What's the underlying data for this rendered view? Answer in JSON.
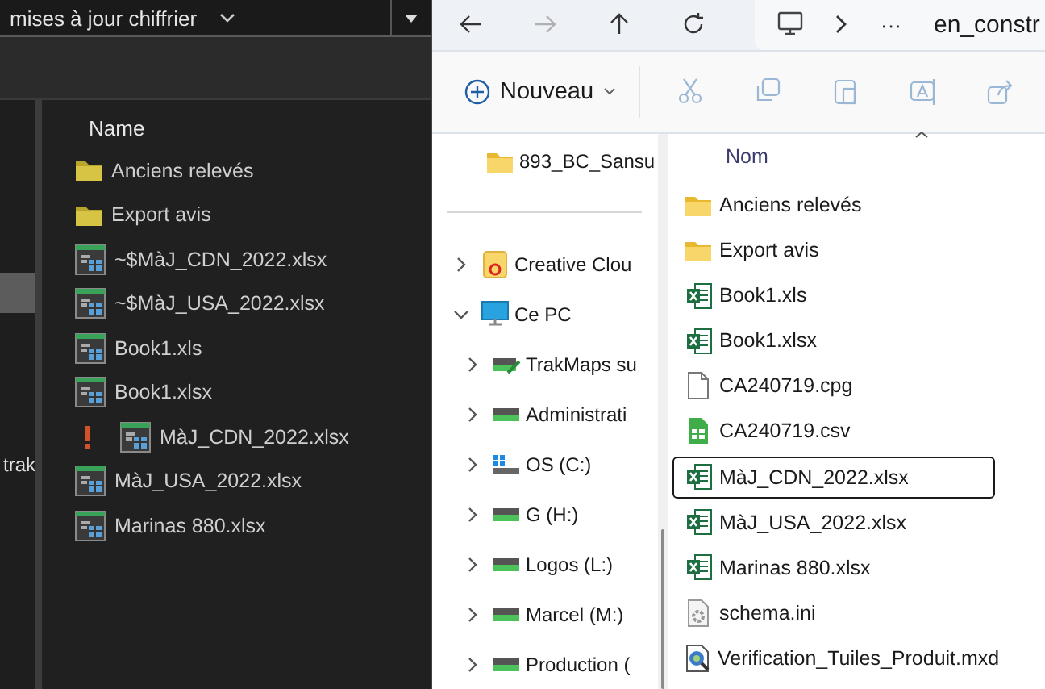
{
  "left_window": {
    "path_field": {
      "value": "mises à jour chiffrier"
    },
    "sidebar": [
      {
        "selected": true
      },
      {
        "label": "trak",
        "selected": false
      }
    ],
    "column": "Name",
    "files": [
      {
        "name": "Anciens relevés",
        "kind": "folder",
        "warning": false
      },
      {
        "name": "Export avis",
        "kind": "folder",
        "warning": false
      },
      {
        "name": "~$MàJ_CDN_2022.xlsx",
        "kind": "sheet",
        "warning": false
      },
      {
        "name": "~$MàJ_USA_2022.xlsx",
        "kind": "sheet",
        "warning": false
      },
      {
        "name": "Book1.xls",
        "kind": "sheet",
        "warning": false
      },
      {
        "name": "Book1.xlsx",
        "kind": "sheet",
        "warning": false
      },
      {
        "name": "MàJ_CDN_2022.xlsx",
        "kind": "sheet",
        "warning": true
      },
      {
        "name": "MàJ_USA_2022.xlsx",
        "kind": "sheet",
        "warning": false
      },
      {
        "name": "Marinas 880.xlsx",
        "kind": "sheet",
        "warning": false
      }
    ]
  },
  "right_window": {
    "nav_buttons": [
      {
        "kind": "back",
        "disabled": false
      },
      {
        "kind": "forward",
        "disabled": true
      },
      {
        "kind": "up",
        "disabled": false
      },
      {
        "kind": "refresh",
        "disabled": false
      }
    ],
    "breadcrumb": {
      "more": "···",
      "segment": "en_constr"
    },
    "toolbar": {
      "new_button": "Nouveau",
      "actions": [
        {
          "kind": "cut",
          "disabled": true
        },
        {
          "kind": "copy",
          "disabled": true
        },
        {
          "kind": "paste",
          "disabled": true
        },
        {
          "kind": "rename",
          "disabled": true
        },
        {
          "kind": "share",
          "disabled": true
        }
      ]
    },
    "pinned": [
      {
        "label": "893_BC_Sansu",
        "kind": "folder"
      }
    ],
    "tree": [
      {
        "label": "Creative Clou",
        "kind": "cloud",
        "expanded": false
      },
      {
        "label": "Ce PC",
        "kind": "pc",
        "expanded": true,
        "children": [
          {
            "label": "TrakMaps su",
            "kind": "network",
            "expanded": false
          },
          {
            "label": "Administrati",
            "kind": "drive",
            "expanded": false
          },
          {
            "label": "OS (C:)",
            "kind": "os",
            "expanded": false
          },
          {
            "label": "G (H:)",
            "kind": "drive",
            "expanded": false
          },
          {
            "label": "Logos (L:)",
            "kind": "drive",
            "expanded": false
          },
          {
            "label": "Marcel (M:)",
            "kind": "drive",
            "expanded": false
          },
          {
            "label": "Production (",
            "kind": "drive",
            "expanded": false
          }
        ]
      }
    ],
    "column": "Nom",
    "files": [
      {
        "name": "Anciens relevés",
        "kind": "folder",
        "focused": false
      },
      {
        "name": "Export avis",
        "kind": "folder",
        "focused": false
      },
      {
        "name": "Book1.xls",
        "kind": "xls",
        "focused": false
      },
      {
        "name": "Book1.xlsx",
        "kind": "xlsx",
        "focused": false
      },
      {
        "name": "CA240719.cpg",
        "kind": "file",
        "focused": false
      },
      {
        "name": "CA240719.csv",
        "kind": "csv",
        "focused": false
      },
      {
        "name": "MàJ_CDN_2022.xlsx",
        "kind": "xlsx",
        "focused": true
      },
      {
        "name": "MàJ_USA_2022.xlsx",
        "kind": "xlsx",
        "focused": false
      },
      {
        "name": "Marinas 880.xlsx",
        "kind": "xlsx",
        "focused": false
      },
      {
        "name": "schema.ini",
        "kind": "ini",
        "focused": false
      },
      {
        "name": "Verification_Tuiles_Produit.mxd",
        "kind": "mxd",
        "focused": false
      }
    ]
  }
}
